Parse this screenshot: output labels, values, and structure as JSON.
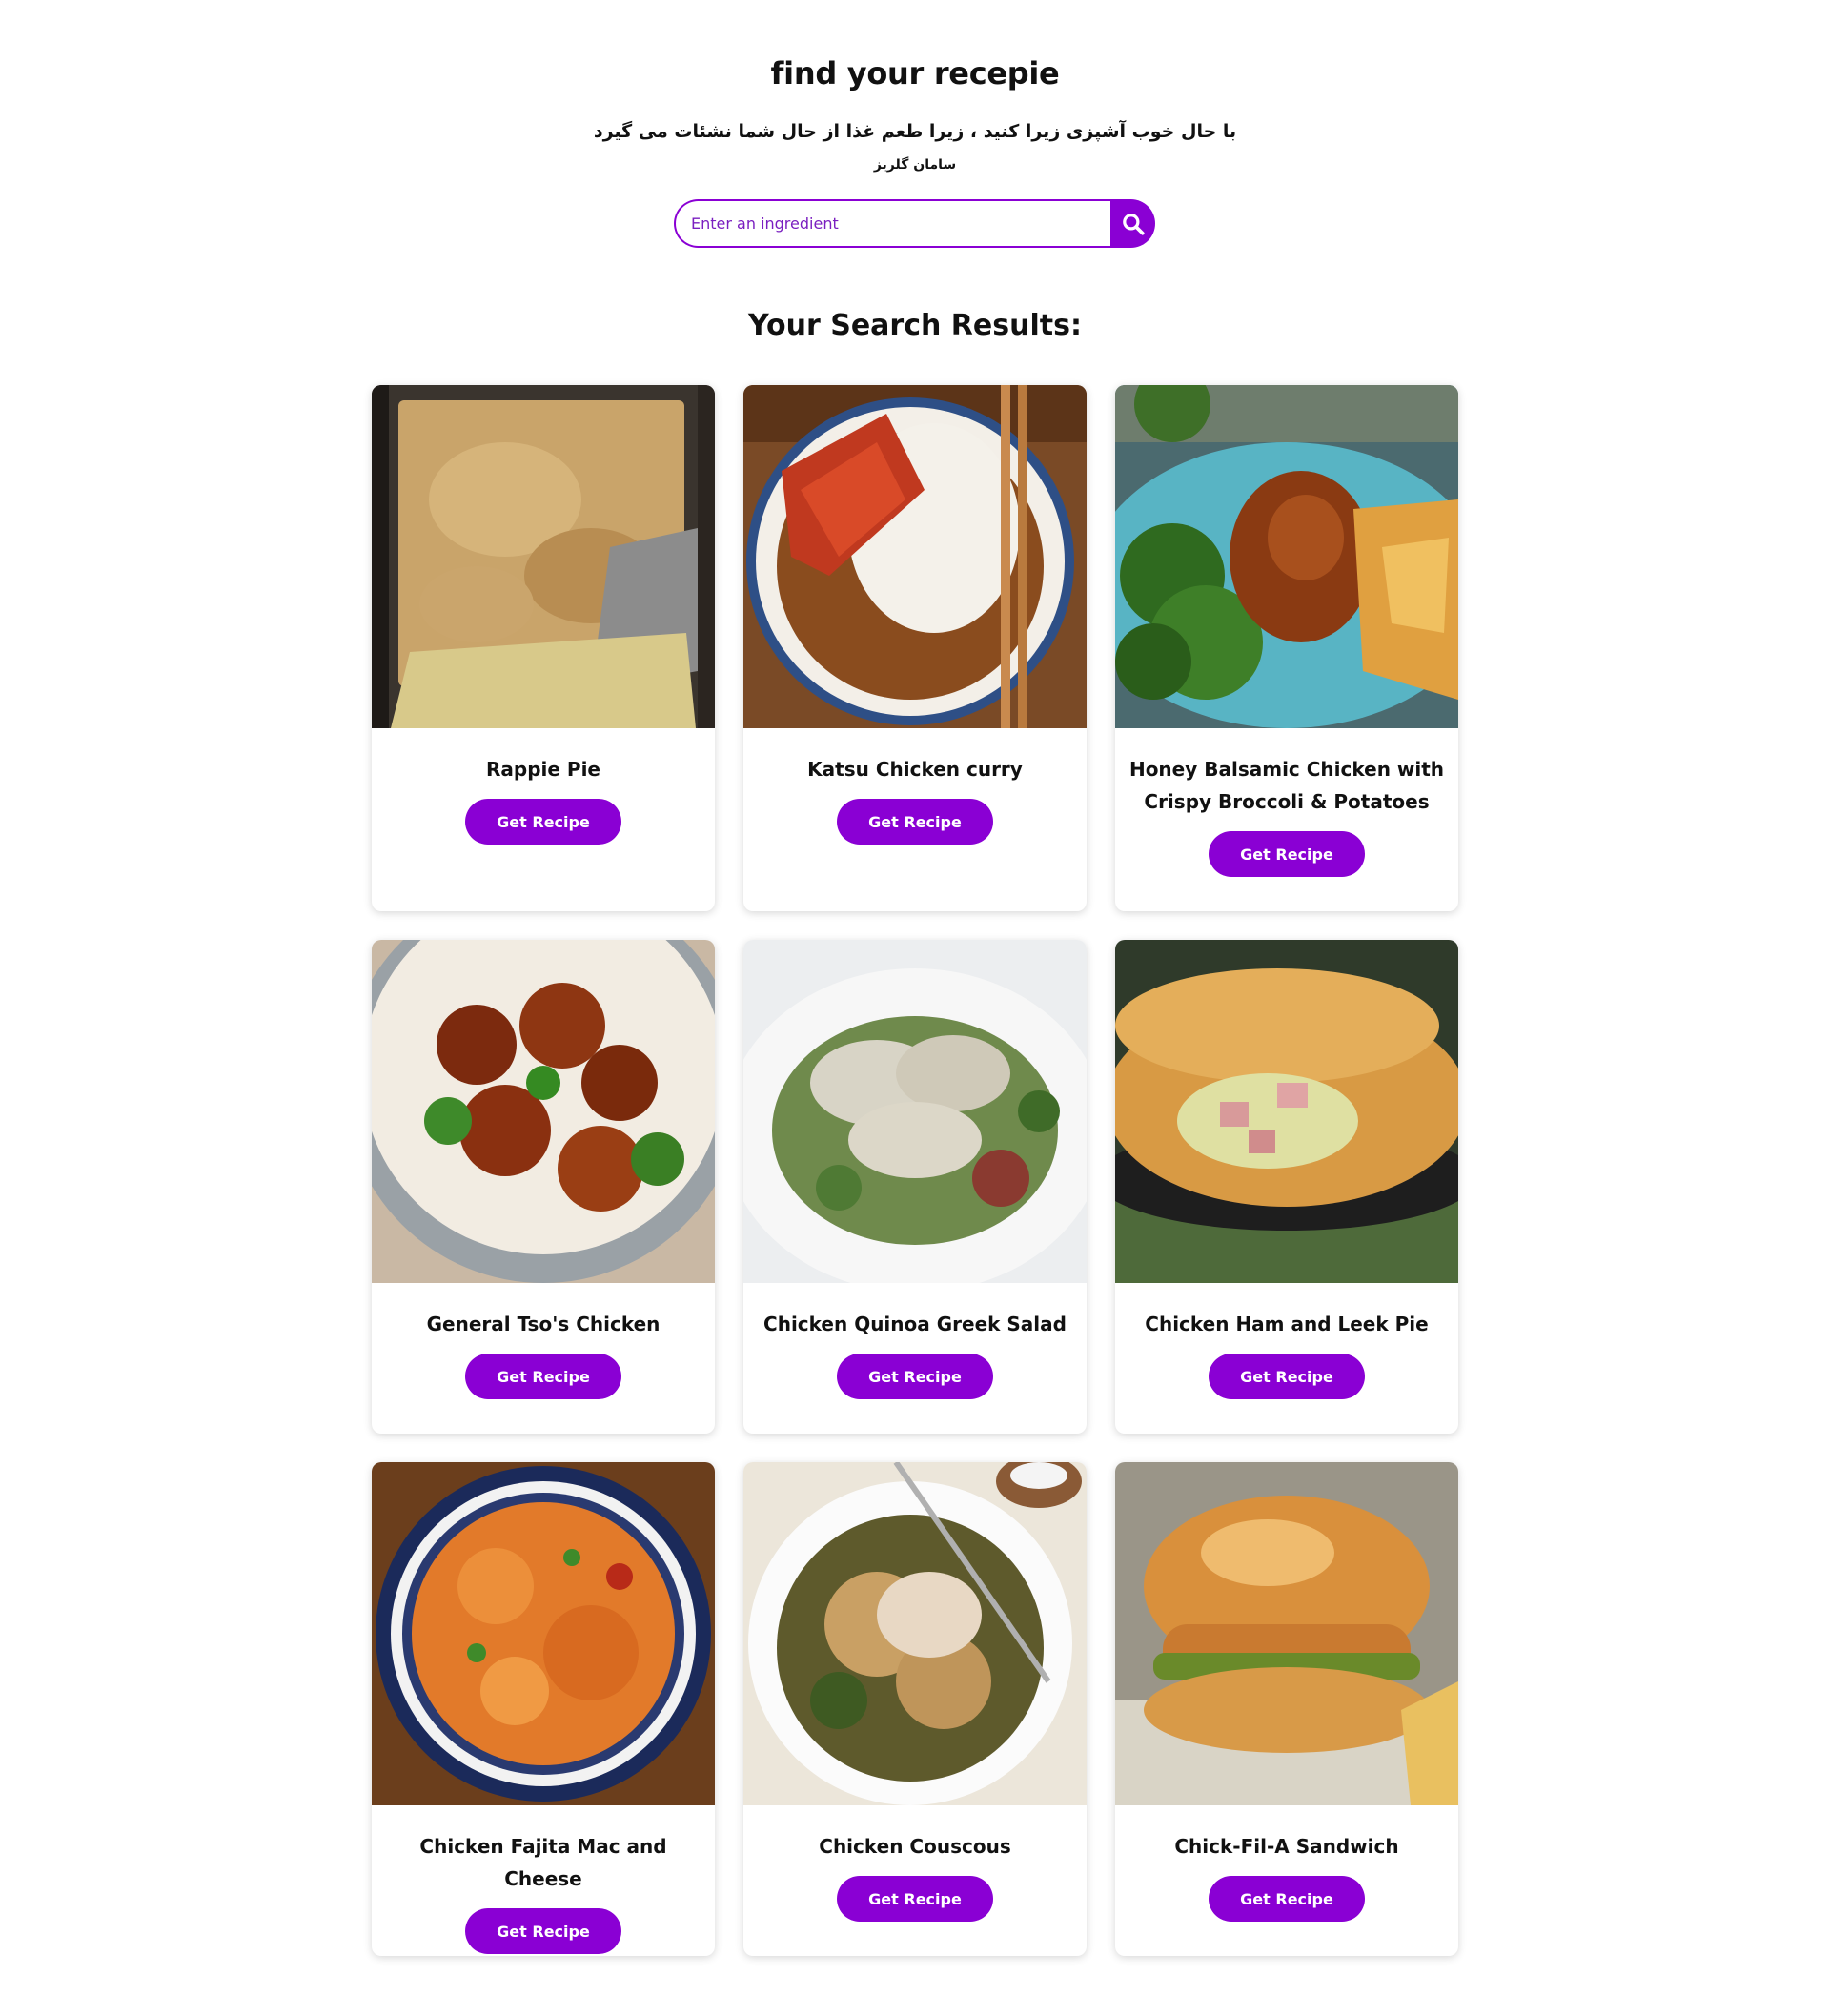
{
  "header": {
    "title": "find your recepie",
    "quote": "با حال خوب آشپزی زیرا کنید ، زیرا طعم غذا از حال شما نشئات می گیرد",
    "quote_author": "سامان گلریز"
  },
  "search": {
    "placeholder": "Enter an ingredient",
    "value": "",
    "button_icon": "search-icon"
  },
  "results": {
    "heading": "Your Search Results:",
    "button_label": "Get Recipe",
    "items": [
      {
        "name": "Rappie Pie",
        "image": "casserole-photo"
      },
      {
        "name": "Katsu Chicken curry",
        "image": "katsu-curry-photo"
      },
      {
        "name": "Honey Balsamic Chicken with Crispy Broccoli & Potatoes",
        "image": "chicken-broccoli-potatoes-photo"
      },
      {
        "name": "General Tso's Chicken",
        "image": "general-tso-bowl-photo"
      },
      {
        "name": "Chicken Quinoa Greek Salad",
        "image": "chicken-salad-photo"
      },
      {
        "name": "Chicken Ham and Leek Pie",
        "image": "pie-skillet-photo"
      },
      {
        "name": "Chicken Fajita Mac and Cheese",
        "image": "mac-and-cheese-photo"
      },
      {
        "name": "Chicken Couscous",
        "image": "couscous-plate-photo"
      },
      {
        "name": "Chick-Fil-A Sandwich",
        "image": "chicken-sandwich-photo"
      }
    ]
  },
  "colors": {
    "accent": "#8a00d4",
    "text": "#111111",
    "background": "#ffffff"
  }
}
